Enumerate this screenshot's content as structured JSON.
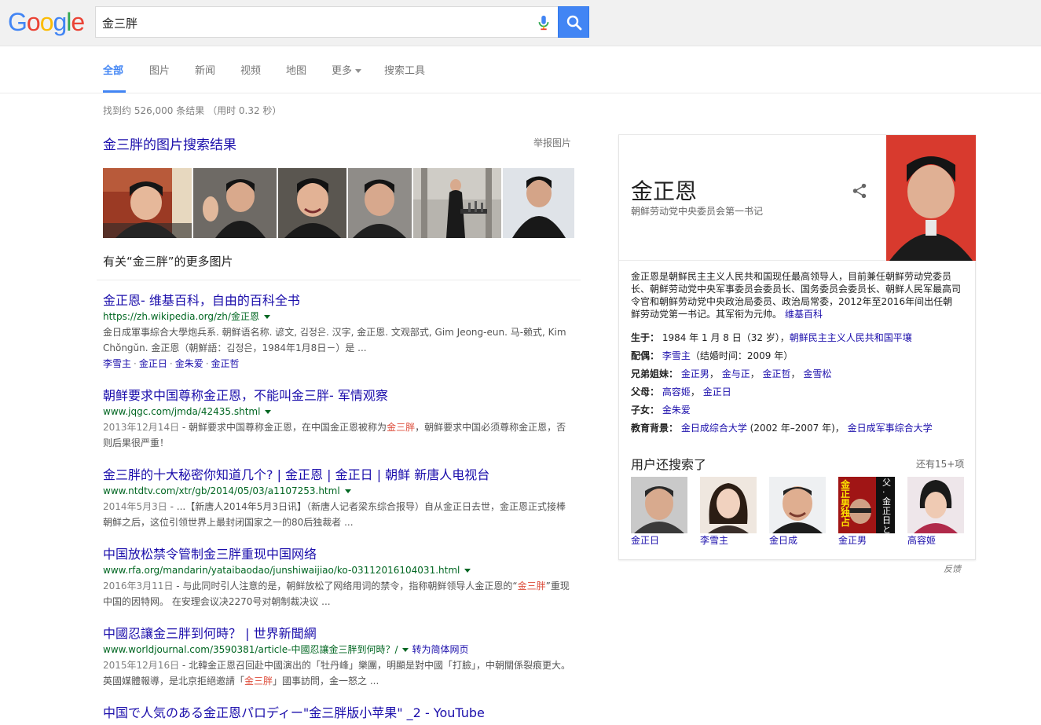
{
  "logo": {
    "letters": [
      "G",
      "o",
      "o",
      "g",
      "l",
      "e"
    ],
    "colors": [
      "#4285f4",
      "#ea4335",
      "#fbbc05",
      "#4285f4",
      "#34a853",
      "#ea4335"
    ]
  },
  "search": {
    "query": "金三胖",
    "accent": "#4285f4"
  },
  "tabs": [
    {
      "label": "全部",
      "active": true
    },
    {
      "label": "图片"
    },
    {
      "label": "新闻"
    },
    {
      "label": "视频"
    },
    {
      "label": "地图"
    },
    {
      "label": "更多"
    },
    {
      "label": "搜索工具"
    }
  ],
  "stats": "找到约 526,000 条结果 （用时 0.32 秒）",
  "images": {
    "title": "金三胖的图片搜索结果",
    "report": "举报图片",
    "more": "有关“金三胖”的更多图片"
  },
  "results": [
    {
      "title": "金正恩- 维基百科，自由的百科全书",
      "url": "https://zh.wikipedia.org/zh/金正恩",
      "snippet": "金日成軍事綜合大學炮兵系. 朝鲜语名称. 谚文, 김정은. 汉字, 金正恩. 文观部式, Gim Jeong-eun. 马-赖式, Kim Chŏngŭn. 金正恩（朝鮮語：김정은，1984年1月8日－）是 ...",
      "links": [
        "李雪主",
        "金正日",
        "金朱爱",
        "金正哲"
      ]
    },
    {
      "title": "朝鲜要求中国尊称金正恩，不能叫金三胖- 军情观察",
      "url": "www.jqgc.com/jmda/42435.shtml",
      "date": "2013年12月14日",
      "snippet_a": " - 朝鲜要求中国尊称金正恩，在中国金正恩被称为",
      "hl": "金三胖",
      "snippet_b": "，朝鲜要求中国必须尊称金正恩，否则后果很严重！"
    },
    {
      "title": "金三胖的十大秘密你知道几个? | 金正恩 | 金正日 | 朝鲜 新唐人电视台",
      "url": "www.ntdtv.com/xtr/gb/2014/05/03/a1107253.html",
      "date": "2014年5月3日",
      "snippet_a": " - ...【新唐人2014年5月3日讯】（新唐人记者梁东综合报导）自从金正日去世，金正恩正式接棒朝鲜之后，这位引领世界上最封闭国家之一的80后独裁者 ..."
    },
    {
      "title": "中国放松禁令管制金三胖重现中国网络",
      "url": "www.rfa.org/mandarin/yataibaodao/junshiwaijiao/ko-03112016104031.html",
      "date": "2016年3月11日",
      "snippet_a": " - 与此同时引人注意的是，朝鲜放松了网络用词的禁令，指称朝鲜领导人金正恩的“",
      "hl": "金三胖",
      "snippet_b": "”重现中国的因特网。 在安理会议决2270号对朝制裁决议 ..."
    },
    {
      "title": "中國忍讓金三胖到何時？ | 世界新聞網",
      "url": "www.worldjournal.com/3590381/article-中國忍讓金三胖到何時？/",
      "translate": "转为简体网页",
      "date": "2015年12月16日",
      "snippet_a": " - 北韓金正恩召回赴中國演出的「牡丹峰」樂團，明顯是對中國「打臉」，中朝關係裂痕更大。英國媒體報導，是北京拒絕邀請「",
      "hl": "金三胖",
      "snippet_b": "」國事訪問，金一怒之 ..."
    },
    {
      "title": "中国で人気のある金正恩パロディー\"金三胖版小苹果\" _2 - YouTube"
    }
  ],
  "kp": {
    "name": "金正恩",
    "subtitle": "朝鲜劳动党中央委员会第一书记",
    "description": "金正恩是朝鲜民主主义人民共和国现任最高领导人，目前兼任朝鲜劳动党委员长、朝鲜劳动党中央军事委员会委员长、国务委员会委员长、朝鲜人民军最高司令官和朝鲜劳动党中央政治局委员、政治局常委，2012年至2016年间出任朝鲜劳动党第一书记。其军衔为元帅。",
    "desc_link": "维基百科",
    "facts": [
      {
        "key": "生于：",
        "parts": [
          {
            "t": " 1984 年 1 月 8 日（32 岁），"
          },
          {
            "t": "朝鲜民主主义人民共和国平壤",
            "link": true
          }
        ]
      },
      {
        "key": "配偶：",
        "parts": [
          {
            "t": " "
          },
          {
            "t": "李雪主",
            "link": true
          },
          {
            "t": "（结婚时间：2009 年）"
          }
        ]
      },
      {
        "key": "兄弟姐妹：",
        "parts": [
          {
            "t": " "
          },
          {
            "t": "金正男",
            "link": true
          },
          {
            "t": "， "
          },
          {
            "t": "金与正",
            "link": true
          },
          {
            "t": "， "
          },
          {
            "t": "金正哲",
            "link": true
          },
          {
            "t": "， "
          },
          {
            "t": "金雪松",
            "link": true
          }
        ]
      },
      {
        "key": "父母：",
        "parts": [
          {
            "t": " "
          },
          {
            "t": "高容姬",
            "link": true
          },
          {
            "t": "， "
          },
          {
            "t": "金正日",
            "link": true
          }
        ]
      },
      {
        "key": "子女：",
        "parts": [
          {
            "t": " "
          },
          {
            "t": "金朱爱",
            "link": true
          }
        ]
      },
      {
        "key": "教育背景：",
        "parts": [
          {
            "t": " "
          },
          {
            "t": "金日成综合大学",
            "link": true
          },
          {
            "t": " (2002 年–2007 年)， "
          },
          {
            "t": "金日成军事综合大学",
            "link": true
          }
        ]
      }
    ],
    "also_title": "用户还搜索了",
    "also_more": "还有15+项",
    "people": [
      {
        "name": "金正日"
      },
      {
        "name": "李雪主"
      },
      {
        "name": "金日成"
      },
      {
        "name": "金正男",
        "overlay": "父·金正日と私",
        "banner": "金正男独占"
      },
      {
        "name": "高容姬"
      }
    ]
  },
  "feedback": "反馈"
}
